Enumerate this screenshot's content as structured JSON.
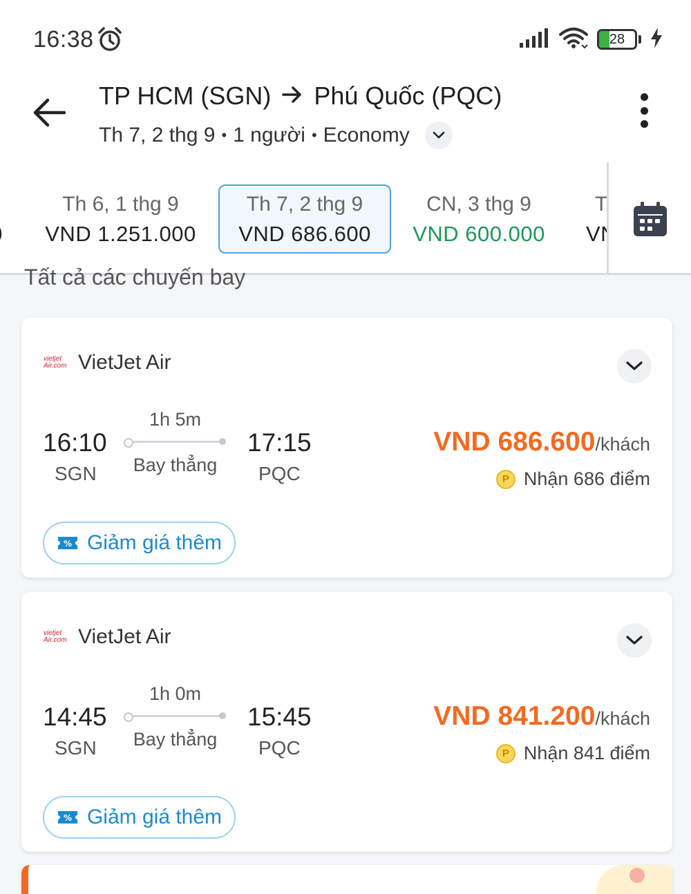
{
  "status_bar": {
    "time": "16:38",
    "battery": "28",
    "battery_level": 0.28,
    "icons": [
      "alarm-icon",
      "signal-icon",
      "wifi-icon",
      "battery-icon",
      "charging-icon"
    ]
  },
  "header": {
    "origin": "TP HCM (SGN)",
    "destination": "Phú Quốc (PQC)",
    "date": "Th 7, 2 thg 9",
    "passengers": "1 người",
    "cabin": "Economy",
    "separator": "•"
  },
  "date_strip": {
    "items": [
      {
        "label": "Th 6, 1 thg 9",
        "price": "VND  1.251.000",
        "selected": false,
        "cheapest": false
      },
      {
        "label": "Th 7, 2 thg 9",
        "price": "VND  686.600",
        "selected": true,
        "cheapest": false
      },
      {
        "label": "CN, 3 thg 9",
        "price": "VND  600.000",
        "selected": false,
        "cheapest": true
      },
      {
        "label": "T",
        "price": "VN",
        "selected": false,
        "cheapest": false
      }
    ]
  },
  "section_title": "Tất cả các chuyến bay",
  "flights": [
    {
      "airline": "VietJet Air",
      "logo_text": "vietjet Air.com",
      "dep_time": "16:10",
      "dep_code": "SGN",
      "arr_time": "17:15",
      "arr_code": "PQC",
      "duration": "1h 5m",
      "stops": "Bay thẳng",
      "price": "VND 686.600",
      "price_unit": "/khách",
      "points": "Nhận 686 điểm",
      "discount_label": "Giảm giá thêm"
    },
    {
      "airline": "VietJet Air",
      "logo_text": "vietjet Air.com",
      "dep_time": "14:45",
      "dep_code": "SGN",
      "arr_time": "15:45",
      "arr_code": "PQC",
      "duration": "1h 0m",
      "stops": "Bay thẳng",
      "price": "VND 841.200",
      "price_unit": "/khách",
      "points": "Nhận 841 điểm",
      "discount_label": "Giảm giá thêm"
    }
  ],
  "colors": {
    "price_orange": "#f26a21",
    "cheapest_green": "#1a9a5a",
    "accent_blue": "#1a8ad0",
    "selected_border": "#4aa3df"
  }
}
